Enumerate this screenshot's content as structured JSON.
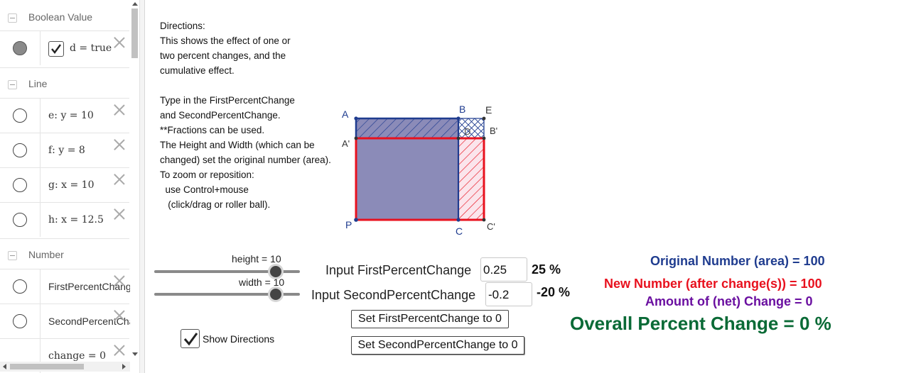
{
  "sidebar": {
    "categories": {
      "boolean": "Boolean Value",
      "line": "Line",
      "number": "Number"
    },
    "rows": {
      "d": "d = true",
      "e": "e: y = 10",
      "f": "f: y = 8",
      "g": "g: x = 10",
      "h": "h: x = 12.5",
      "first": "FirstPercentChange",
      "second": "SecondPercentChange",
      "change": "change = 0"
    }
  },
  "directions": [
    "Directions:",
    "This shows the effect of one or",
    "two percent changes, and the",
    "cumulative effect.",
    "",
    "Type in the FirstPercentChange",
    "and SecondPercentChange.",
    "**Fractions can be used.",
    "The Height and Width (which can be",
    "changed) set the original number (area).",
    "To zoom or reposition:",
    "  use Control+mouse",
    "   (click/drag or roller ball)."
  ],
  "diagram": {
    "points": {
      "A": "A",
      "B": "B",
      "E": "E",
      "A_prime": "A'",
      "B_prime": "B'",
      "P": "P",
      "C": "C",
      "C_prime": "C'",
      "D": "D"
    }
  },
  "sliders": {
    "height": {
      "label": "height = 10",
      "value": 10,
      "min": 0,
      "max": 12
    },
    "width": {
      "label": "width = 10",
      "value": 10,
      "min": 0,
      "max": 12
    }
  },
  "inputs": {
    "first": {
      "label": "Input FirstPercentChange",
      "value": "0.25",
      "percent": "25 %"
    },
    "second": {
      "label": "Input SecondPercentChange",
      "value": "-0.2",
      "percent": "-20 %"
    }
  },
  "buttons": {
    "reset_first": "Set FirstPercentChange to 0",
    "reset_second": "Set SecondPercentChange to 0"
  },
  "show_directions": {
    "label": "Show Directions",
    "checked": true
  },
  "results": {
    "original": "Original Number (area) = 100",
    "new": "New Number (after change(s)) = 100",
    "amount": "Amount of (net) Change = 0",
    "overall": "Overall Percent Change = 0 %"
  },
  "colors": {
    "blue": "#1f3c8f",
    "red": "#e8111e",
    "purple": "#6a0fa0",
    "green": "#0a6a36",
    "fill": "#8b8bb8"
  }
}
